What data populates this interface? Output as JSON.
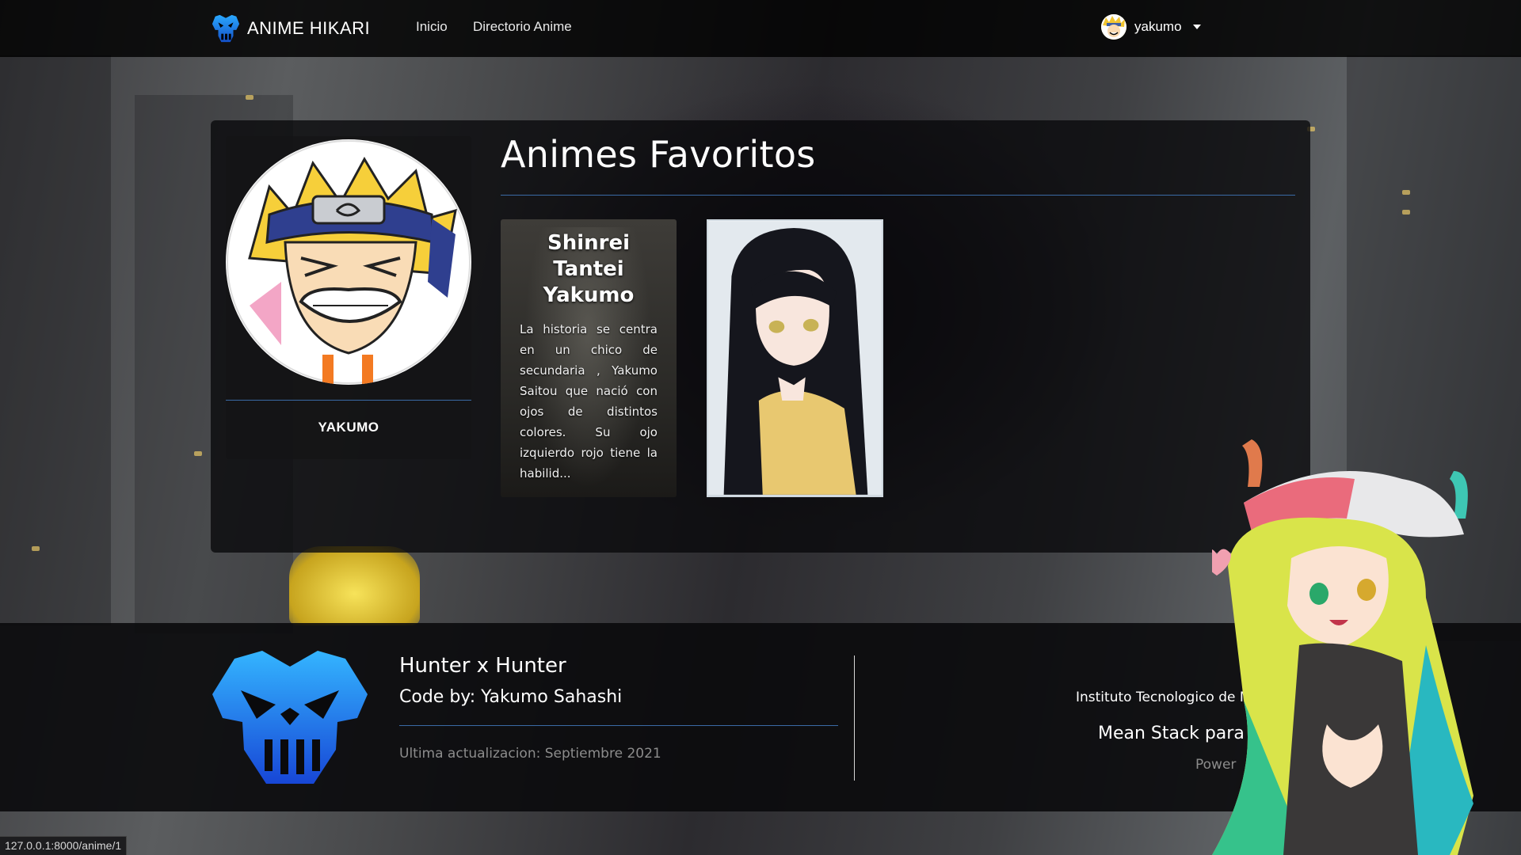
{
  "navbar": {
    "brand": "ANIME HIKARI",
    "links": [
      {
        "label": "Inicio"
      },
      {
        "label": "Directorio Anime"
      }
    ],
    "user": {
      "name": "yakumo"
    }
  },
  "profile": {
    "name": "YAKUMO"
  },
  "favorites": {
    "title": "Animes Favoritos",
    "cards": [
      {
        "title": "Shinrei Tantei Yakumo",
        "description": "La historia se centra en un chico de secundaria , Yakumo Saitou que nació con ojos de distintos colores. Su ojo izquierdo rojo tiene la habilid..."
      }
    ]
  },
  "footer": {
    "title": "Hunter x Hunter",
    "code_by": "Code by: Yakumo Sahashi",
    "last_update": "Ultima actualizacion: Septiembre 2021",
    "institute": "Instituto Tecnologico de Milp",
    "stack": "Mean Stack para Ba",
    "powered": "Power"
  },
  "statusbar": {
    "url": "127.0.0.1:8000/anime/1"
  },
  "colors": {
    "accent_divider": "#3a6aa5",
    "logo_blue": "#1e7cf0",
    "muted_text": "#8c8c8c"
  },
  "icons": {
    "brand": "skull-logo-icon",
    "user_caret": "caret-down-icon"
  }
}
